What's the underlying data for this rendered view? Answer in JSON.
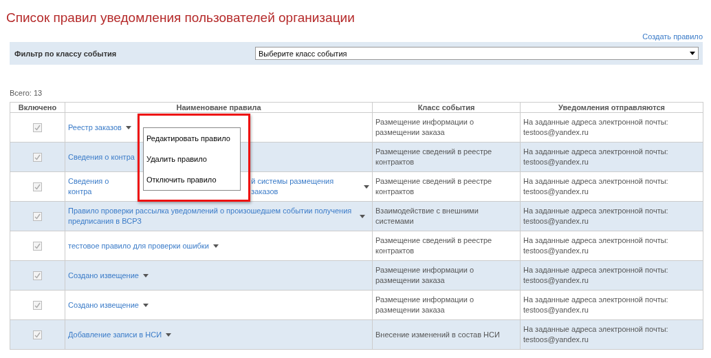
{
  "title": "Список правил уведомления пользователей организации",
  "create_link": "Создать правило",
  "filter": {
    "label": "Фильтр по классу события",
    "select_value": "Выберите класс события"
  },
  "total": "Всего: 13",
  "table": {
    "columns": [
      "Включено",
      "Наименоване правила",
      "Класс события",
      "Уведомления отправляются"
    ],
    "rows": [
      {
        "checked": true,
        "name_parts": [
          "Реестр заказов"
        ],
        "event_class": "Размещение информации о размещении заказа",
        "recipients": "На заданные адреса электронной почты: testoos@yandex.ru"
      },
      {
        "checked": true,
        "name_parts": [
          "Сведения о контра"
        ],
        "event_class": "Размещение сведений в реестре контрактов",
        "recipients": "На заданные адреса электронной почты: testoos@yandex.ru"
      },
      {
        "checked": true,
        "name_parts": [
          "Сведения о контра",
          "й системы размещения заказов"
        ],
        "event_class": "Размещение сведений в реестре контрактов",
        "recipients": "На заданные адреса электронной почты: testoos@yandex.ru"
      },
      {
        "checked": true,
        "name_parts": [
          "Правило проверки рассылка уведомлений о произошедшем событии получения предписания в ВСРЗ"
        ],
        "event_class": "Взаимодействие с внешними системами",
        "recipients": "На заданные адреса электронной почты: testoos@yandex.ru"
      },
      {
        "checked": true,
        "name_parts": [
          "тестовое правило для проверки ошибки"
        ],
        "event_class": "Размещение сведений в реестре контрактов",
        "recipients": "На заданные адреса электронной почты: testoos@yandex.ru"
      },
      {
        "checked": true,
        "name_parts": [
          "Создано извещение"
        ],
        "event_class": "Размещение информации о размещении заказа",
        "recipients": "На заданные адреса электронной почты: testoos@yandex.ru"
      },
      {
        "checked": true,
        "name_parts": [
          "Создано извещение"
        ],
        "event_class": "Размещение информации о размещении заказа",
        "recipients": "На заданные адреса электронной почты: testoos@yandex.ru"
      },
      {
        "checked": true,
        "name_parts": [
          "Добавление записи в НСИ"
        ],
        "event_class": "Внесение изменений в состав НСИ",
        "recipients": "На заданные адреса электронной почты: testoos@yandex.ru"
      }
    ]
  },
  "context_menu": {
    "items": [
      "Редактировать правило",
      "Удалить правило",
      "Отключить правило"
    ]
  }
}
